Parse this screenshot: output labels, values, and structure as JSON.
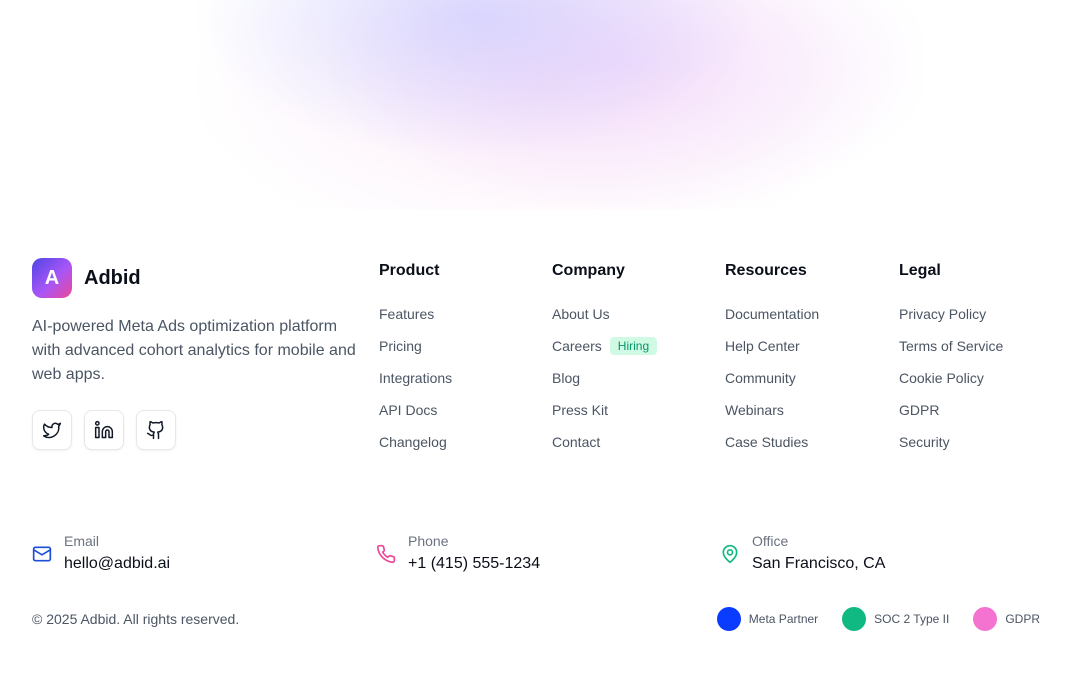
{
  "brand": {
    "logo_letter": "A",
    "name": "Adbid",
    "tagline": "AI-powered Meta Ads optimization platform with advanced cohort analytics for mobile and web apps.",
    "logo_gradient": [
      "#4f46e5",
      "#a855f7",
      "#ec4899"
    ]
  },
  "socials": [
    {
      "icon": "twitter-icon"
    },
    {
      "icon": "linkedin-icon"
    },
    {
      "icon": "github-icon"
    }
  ],
  "columns": {
    "product": {
      "title": "Product",
      "links": [
        "Features",
        "Pricing",
        "Integrations",
        "API Docs",
        "Changelog"
      ]
    },
    "company": {
      "title": "Company",
      "links": [
        "About Us",
        "Careers",
        "Blog",
        "Press Kit",
        "Contact"
      ],
      "careers_badge": "Hiring"
    },
    "resources": {
      "title": "Resources",
      "links": [
        "Documentation",
        "Help Center",
        "Community",
        "Webinars",
        "Case Studies"
      ]
    },
    "legal": {
      "title": "Legal",
      "links": [
        "Privacy Policy",
        "Terms of Service",
        "Cookie Policy",
        "GDPR",
        "Security"
      ]
    }
  },
  "contact": {
    "email": {
      "label": "Email",
      "value": "hello@adbid.ai",
      "icon": "mail-icon",
      "color": "#1d4ed8"
    },
    "phone": {
      "label": "Phone",
      "value": "+1 (415) 555-1234",
      "icon": "phone-icon",
      "color": "#ec4899"
    },
    "office": {
      "label": "Office",
      "value": "San Francisco, CA",
      "icon": "map-pin-icon",
      "color": "#10b981"
    }
  },
  "copyright": "© 2025 Adbid. All rights reserved.",
  "certifications": [
    {
      "label": "Meta Partner",
      "color": "#0a3cff"
    },
    {
      "label": "SOC 2 Type II",
      "color": "#10b981"
    },
    {
      "label": "GDPR",
      "color": "#f472d0"
    }
  ]
}
